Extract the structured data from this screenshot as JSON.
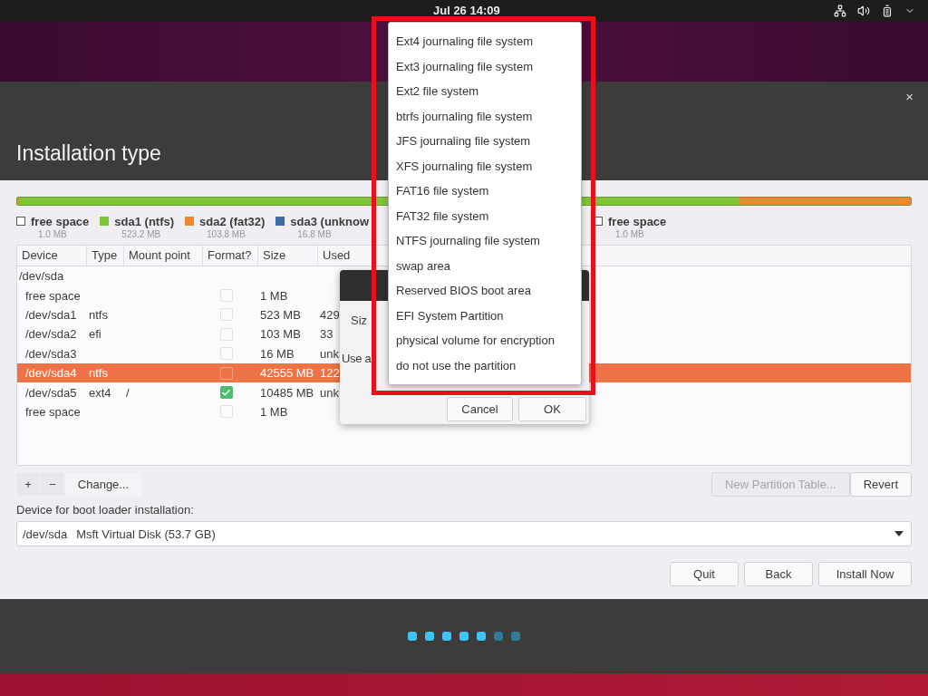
{
  "top_bar": {
    "clock": "Jul 26  14:09"
  },
  "window": {
    "title": "Installation type",
    "close": "×"
  },
  "legend": [
    {
      "label": "free space",
      "size": "1.0 MB",
      "color": "#ffffff"
    },
    {
      "label": "sda1 (ntfs)",
      "size": "523.2 MB",
      "color": "#7ec535"
    },
    {
      "label": "sda2 (fat32)",
      "size": "103.8 MB",
      "color": "#f0882f"
    },
    {
      "label": "sda3 (unknow",
      "size": "16.8 MB",
      "color": "#3f6aa8"
    },
    {
      "label": "free space",
      "size": "1.0 MB",
      "color": "#ffffff"
    }
  ],
  "table": {
    "columns": [
      "Device",
      "Type",
      "Mount point",
      "Format?",
      "Size",
      "Used"
    ],
    "rows": [
      {
        "device": "/dev/sda",
        "selected": false,
        "children": [
          {
            "device": "free space",
            "format": false,
            "size": "1 MB",
            "selected": false
          },
          {
            "device": "/dev/sda1",
            "type": "ntfs",
            "format": false,
            "size": "523 MB",
            "used": "429",
            "selected": false
          },
          {
            "device": "/dev/sda2",
            "type": "efi",
            "format": false,
            "size": "103 MB",
            "used": "33",
            "selected": false
          },
          {
            "device": "/dev/sda3",
            "format": false,
            "size": "16 MB",
            "used": "unk",
            "selected": false
          },
          {
            "device": "/dev/sda4",
            "type": "ntfs",
            "format": false,
            "size": "42555 MB",
            "used": "122",
            "selected": true
          },
          {
            "device": "/dev/sda5",
            "type": "ext4",
            "mount": "/",
            "format": true,
            "size": "10485 MB",
            "used": "unk",
            "selected": false
          },
          {
            "device": "free space",
            "format": false,
            "size": "1 MB",
            "selected": false
          }
        ]
      }
    ]
  },
  "toolbar": {
    "add": "+",
    "remove": "−",
    "change": "Change...",
    "new_partition_table": {
      "label": "New Partition Table...",
      "disabled": true
    },
    "revert": "Revert"
  },
  "boot_loader": {
    "label": "Device for boot loader installation:",
    "device": "/dev/sda",
    "description": "Msft Virtual Disk (53.7 GB)"
  },
  "buttons": [
    "Quit",
    "Back",
    "Install Now"
  ],
  "progress_dots": [
    {
      "done": true
    },
    {
      "done": true
    },
    {
      "done": true
    },
    {
      "done": true
    },
    {
      "done": true
    },
    {
      "done": false
    },
    {
      "done": false
    }
  ],
  "dialog": {
    "size_label": "Siz",
    "use_as_label": "Use a",
    "buttons": [
      "Cancel",
      "OK"
    ]
  },
  "dropdown": {
    "items": [
      {
        "label": "Ext4 journaling file system",
        "selected": false
      },
      {
        "label": "Ext3 journaling file system",
        "selected": false
      },
      {
        "label": "Ext2 file system",
        "selected": false
      },
      {
        "label": "btrfs journaling file system",
        "selected": false
      },
      {
        "label": "JFS journaling file system",
        "selected": false
      },
      {
        "label": "XFS journaling file system",
        "selected": false
      },
      {
        "label": "FAT16 file system",
        "selected": false
      },
      {
        "label": "FAT32 file system",
        "selected": false
      },
      {
        "label": "NTFS journaling file system",
        "selected": false
      },
      {
        "label": "swap area",
        "selected": false
      },
      {
        "label": "Reserved BIOS boot area",
        "selected": false
      },
      {
        "label": "EFI System Partition",
        "selected": false
      },
      {
        "label": "physical volume for encryption",
        "selected": false
      },
      {
        "label": "do not use the partition",
        "selected": false
      }
    ]
  }
}
